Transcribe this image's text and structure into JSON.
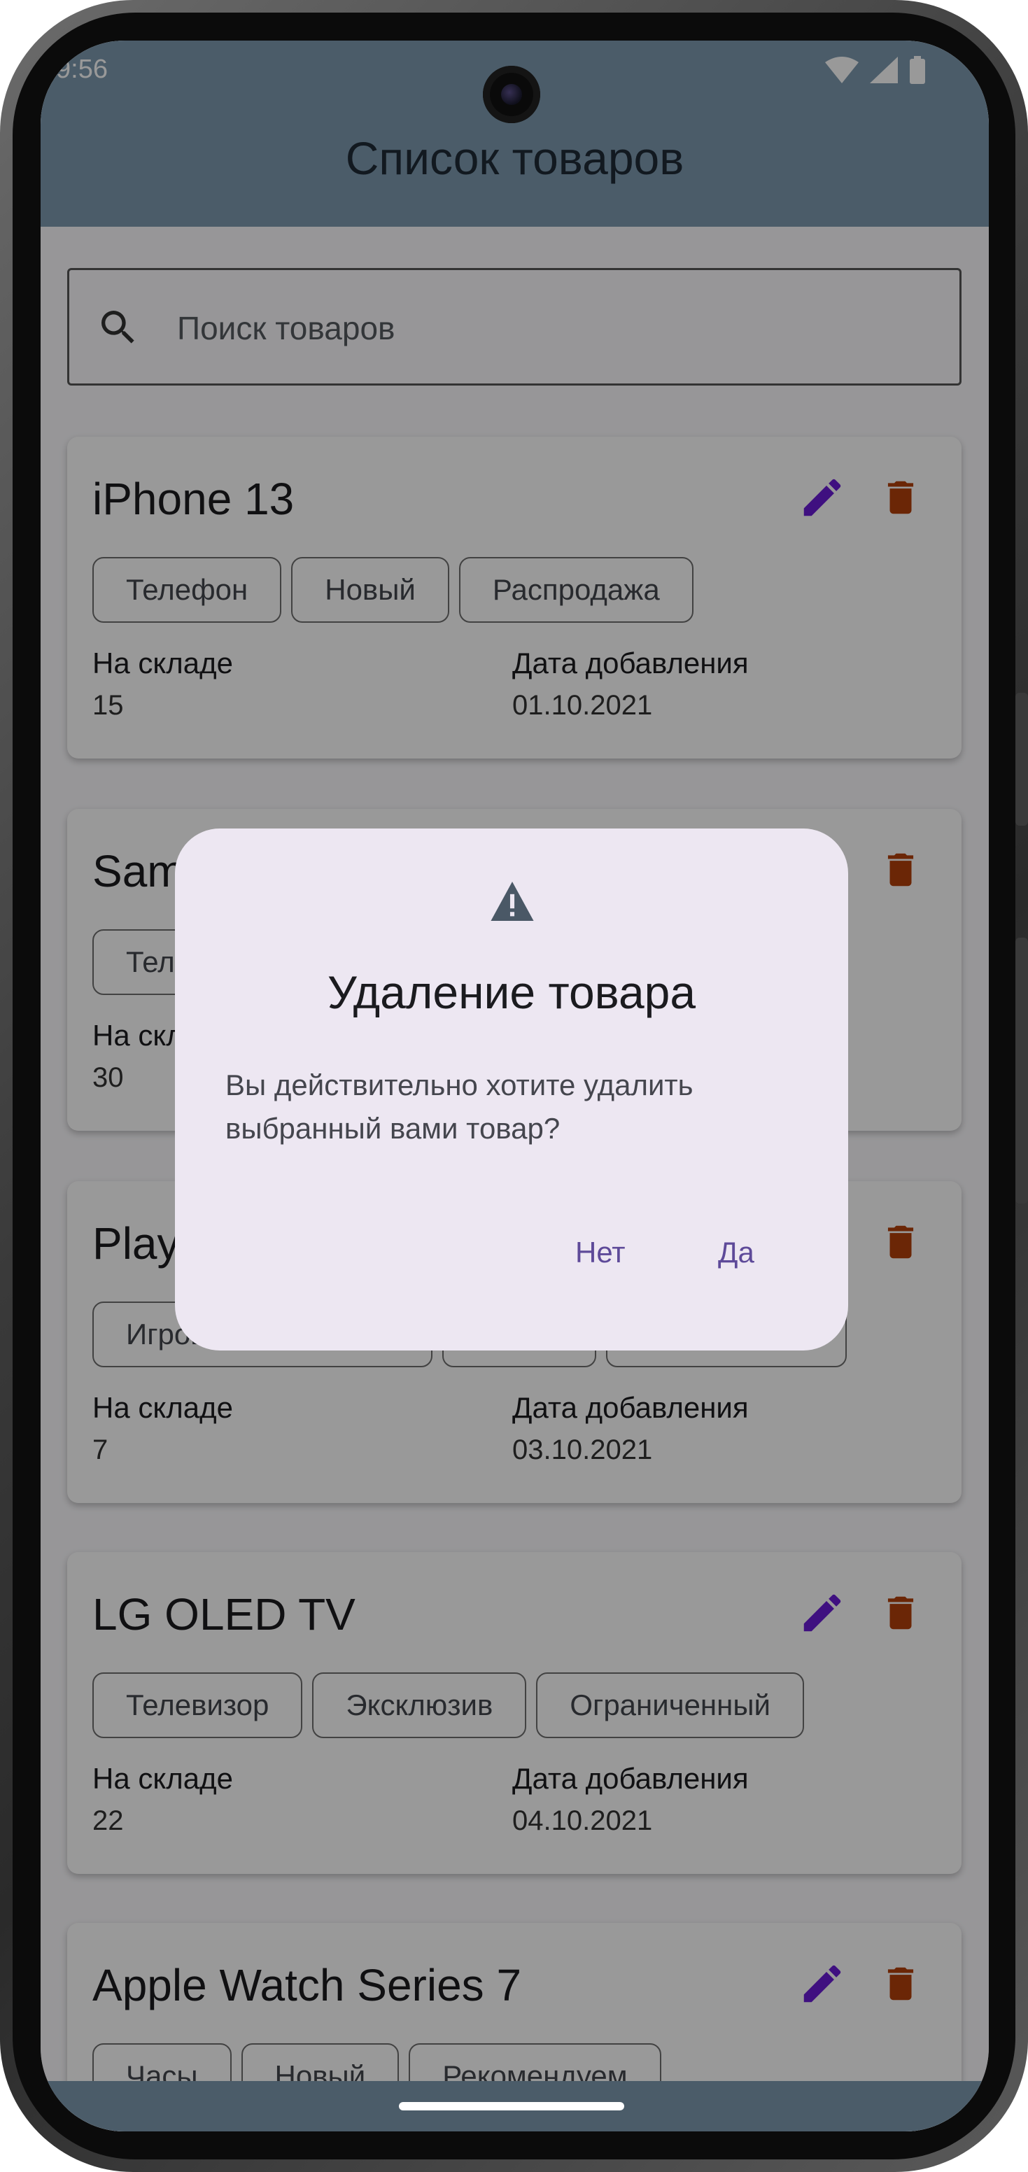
{
  "status_bar": {
    "time": "9:56"
  },
  "app_bar": {
    "title": "Список товаров"
  },
  "search": {
    "placeholder": "Поиск товаров"
  },
  "labels": {
    "stock": "На складе",
    "date_added": "Дата добавления"
  },
  "products": [
    {
      "name": "iPhone 13",
      "tags": [
        "Телефон",
        "Новый",
        "Распродажа"
      ],
      "stock": "15",
      "date": "01.10.2021"
    },
    {
      "name": "Sam",
      "tags": [
        "Тел"
      ],
      "stock": "30",
      "date": ""
    },
    {
      "name": "Play",
      "tags": [
        "Игров"
      ],
      "stock": "7",
      "date": "03.10.2021"
    },
    {
      "name": "LG OLED TV",
      "tags": [
        "Телевизор",
        "Эксклюзив",
        "Ограниченный"
      ],
      "stock": "22",
      "date": "04.10.2021"
    },
    {
      "name": "Apple Watch Series 7",
      "tags": [
        "Часы",
        "Новый",
        "Рекомендуем"
      ],
      "stock": "",
      "date": ""
    }
  ],
  "dialog": {
    "icon": "warning-icon",
    "title": "Удаление товара",
    "message": "Вы действительно хотите удалить выбранный вами товар?",
    "cancel_label": "Нет",
    "confirm_label": "Да"
  },
  "colors": {
    "app_bar": "#7d9ab0",
    "edit_icon": "#6a1bd6",
    "delete_icon": "#b3400a",
    "dialog_bg": "#ede7f2",
    "dialog_button": "#5e4a99"
  }
}
